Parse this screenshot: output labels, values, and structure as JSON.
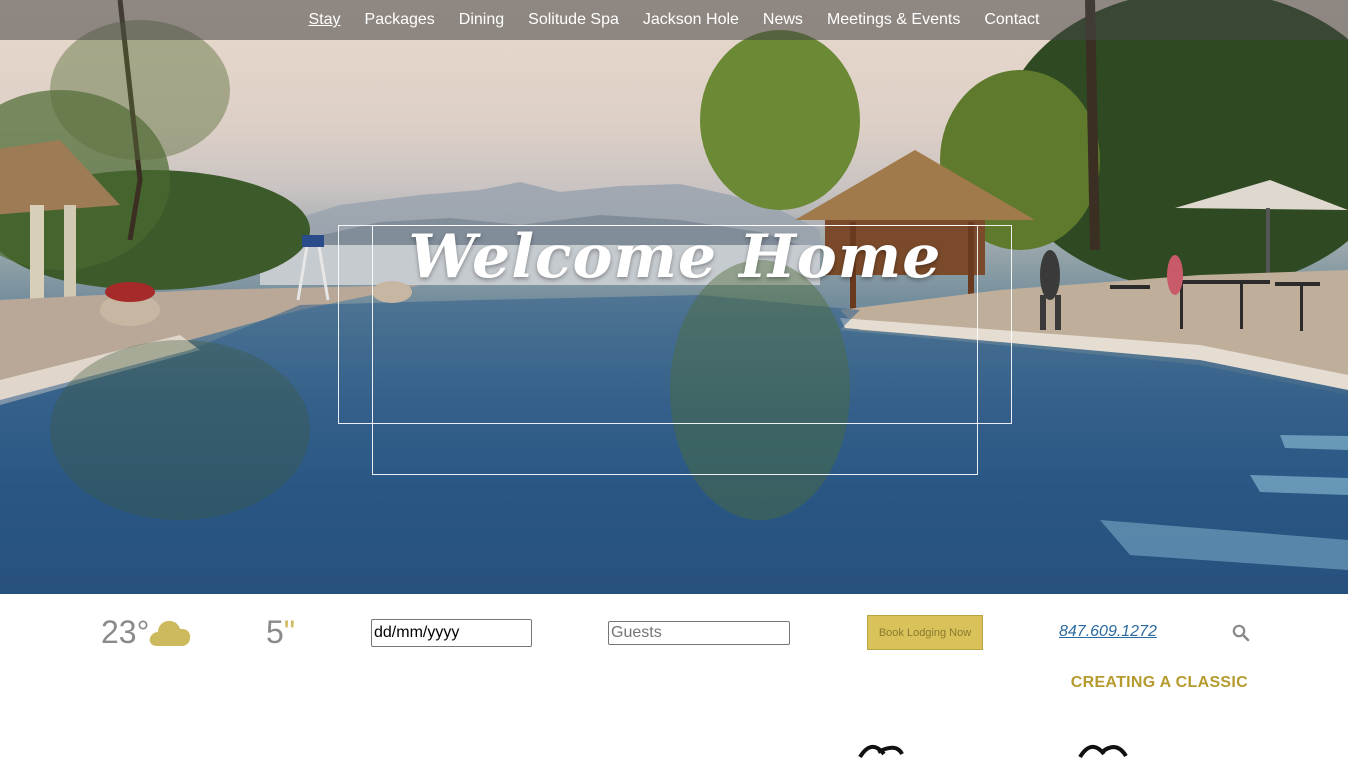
{
  "nav": {
    "items": [
      {
        "label": "Stay",
        "active": true
      },
      {
        "label": "Packages"
      },
      {
        "label": "Dining"
      },
      {
        "label": "Solitude Spa"
      },
      {
        "label": "Jackson Hole"
      },
      {
        "label": "News"
      },
      {
        "label": "Meetings & Events"
      },
      {
        "label": "Contact"
      }
    ]
  },
  "hero": {
    "title": "Welcome Home"
  },
  "booking": {
    "temperature": "23°",
    "weather_icon": "cloud-icon",
    "snow_value": "5",
    "snow_unit": "\"",
    "date_value": "dd/mm/yyyy",
    "guests_placeholder": "Guests",
    "book_label": "Book Lodging Now",
    "phone": "847.609.1272",
    "search_icon": "search-icon"
  },
  "section": {
    "tagline": "CREATING A CLASSIC"
  },
  "colors": {
    "accent_gold": "#d9c25a",
    "tagline_gold": "#b59b2e",
    "link_blue": "#2a6aa0",
    "weather_gray": "#8a8a8a"
  }
}
